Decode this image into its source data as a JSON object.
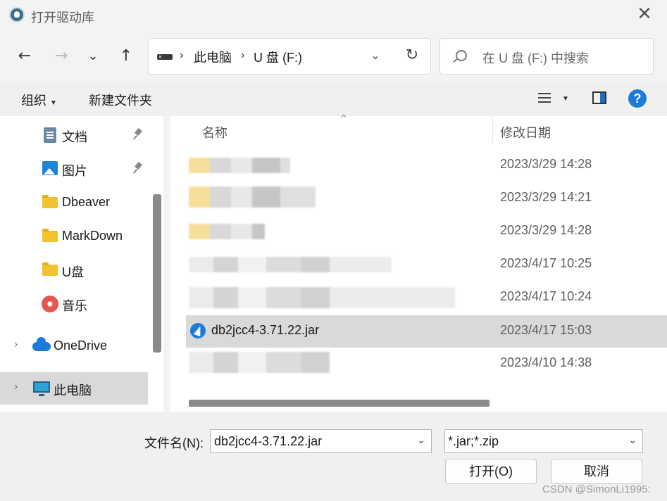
{
  "window": {
    "title": "打开驱动库",
    "close_glyph": "✕"
  },
  "nav": {
    "back_glyph": "←",
    "forward_glyph": "→",
    "recent_glyph": "⌄",
    "up_glyph": "↑",
    "address": {
      "crumbs": [
        "此电脑",
        "U 盘 (F:)"
      ],
      "separator": "›",
      "dropdown_glyph": "⌄",
      "refresh_glyph": "↻"
    },
    "search_placeholder": "在 U 盘 (F:) 中搜索"
  },
  "toolbar": {
    "organize_label": "组织",
    "new_folder_label": "新建文件夹",
    "help_label": "?"
  },
  "sidebar": {
    "items": [
      {
        "label": "文档",
        "icon": "document-icon",
        "pinned": true
      },
      {
        "label": "图片",
        "icon": "picture-icon",
        "pinned": true
      },
      {
        "label": "Dbeaver",
        "icon": "folder-icon"
      },
      {
        "label": "MarkDown",
        "icon": "folder-icon"
      },
      {
        "label": "U盘",
        "icon": "folder-icon"
      },
      {
        "label": "音乐",
        "icon": "music-icon"
      },
      {
        "label": "OneDrive",
        "icon": "onedrive-icon",
        "expandable": true
      },
      {
        "label": "此电脑",
        "icon": "computer-icon",
        "expandable": true,
        "selected": true
      }
    ],
    "expand_glyph": "›"
  },
  "files": {
    "columns": {
      "name": "名称",
      "modified": "修改日期"
    },
    "sort_glyph": "^",
    "rows": [
      {
        "name": "",
        "date": "2023/3/29 14:28",
        "obscured": true
      },
      {
        "name": "",
        "date": "2023/3/29 14:21",
        "obscured": true
      },
      {
        "name": "",
        "date": "2023/3/29 14:28",
        "obscured": true
      },
      {
        "name": "",
        "date": "2023/4/17 10:25",
        "obscured": true
      },
      {
        "name": "",
        "date": "2023/4/17 10:24",
        "obscured": true
      },
      {
        "name": "db2jcc4-3.71.22.jar",
        "date": "2023/4/17 15:03",
        "selected": true
      },
      {
        "name": "",
        "date": "2023/4/10 14:38",
        "obscured": true
      }
    ]
  },
  "footer": {
    "filename_label": "文件名(N):",
    "filename_value": "db2jcc4-3.71.22.jar",
    "filetype_value": "*.jar;*.zip",
    "open_label": "打开(O)",
    "cancel_label": "取消",
    "dropdown_glyph": "⌄"
  },
  "watermark": "CSDN @SimonLi1995:"
}
